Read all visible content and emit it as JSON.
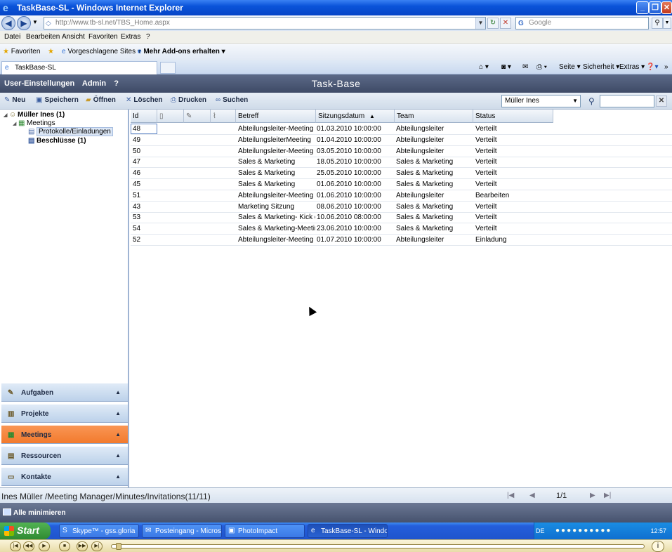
{
  "browser": {
    "title": "TaskBase-SL - Windows Internet Explorer",
    "address": "http://www.tb-sl.net/TBS_Home.aspx",
    "search_placeholder": "Google",
    "menu": [
      "Datei",
      "Bearbeiten",
      "Ansicht",
      "Favoriten",
      "Extras",
      "?"
    ],
    "favorites_label": "Favoriten",
    "suggested_sites": "Vorgeschlagene Sites",
    "addons": "Mehr Add-ons erhalten",
    "tab_label": "TaskBase-SL",
    "commands": [
      "Seite",
      "Sicherheit",
      "Extras"
    ]
  },
  "app": {
    "links": [
      "User-Einstellungen",
      "Admin",
      "?"
    ],
    "title": "Task-Base",
    "toolbar": {
      "new": "Neu",
      "save": "Speichern",
      "open": "Öffnen",
      "delete": "Löschen",
      "print": "Drucken",
      "search": "Suchen"
    },
    "user_select": "Müller Ines"
  },
  "tree": {
    "root": "Müller Ines",
    "root_count": "(1)",
    "meetings": "Meetings",
    "protocols": "Protokolle/Einladungen",
    "decisions": "Beschlüsse",
    "decisions_count": "(1)"
  },
  "accordion": [
    "Aufgaben",
    "Projekte",
    "Meetings",
    "Ressourcen",
    "Kontakte"
  ],
  "grid": {
    "headers": {
      "id": "Id",
      "subject": "Betreff",
      "date": "Sitzungsdatum",
      "sort": "▲",
      "team": "Team",
      "status": "Status"
    },
    "rows": [
      {
        "id": "48",
        "subject": "Abteilungsleiter-Meeting",
        "date": "01.03.2010 10:00:00",
        "team": "Abteilungsleiter",
        "status": "Verteilt"
      },
      {
        "id": "49",
        "subject": "AbteilungsleiterMeeting",
        "date": "01.04.2010 10:00:00",
        "team": "Abteilungsleiter",
        "status": "Verteilt"
      },
      {
        "id": "50",
        "subject": "Abteilungsleiter-Meeting",
        "date": "03.05.2010 10:00:00",
        "team": "Abteilungsleiter",
        "status": "Verteilt"
      },
      {
        "id": "47",
        "subject": "Sales & Marketing",
        "date": "18.05.2010 10:00:00",
        "team": "Sales & Marketing",
        "status": "Verteilt"
      },
      {
        "id": "46",
        "subject": "Sales & Marketing",
        "date": "25.05.2010 10:00:00",
        "team": "Sales & Marketing",
        "status": "Verteilt"
      },
      {
        "id": "45",
        "subject": "Sales & Marketing",
        "date": "01.06.2010 10:00:00",
        "team": "Sales & Marketing",
        "status": "Verteilt"
      },
      {
        "id": "51",
        "subject": "Abteilungsleiter-Meeting",
        "date": "01.06.2010 10:00:00",
        "team": "Abteilungsleiter",
        "status": "Bearbeiten"
      },
      {
        "id": "43",
        "subject": "Marketing Sitzung",
        "date": "08.06.2010 10:00:00",
        "team": "Sales & Marketing",
        "status": "Verteilt"
      },
      {
        "id": "53",
        "subject": "Sales & Marketing- Kick of",
        "date": "10.06.2010 08:00:00",
        "team": "Sales & Marketing",
        "status": "Verteilt"
      },
      {
        "id": "54",
        "subject": "Sales & Marketing-Meeting",
        "date": "23.06.2010 10:00:00",
        "team": "Sales & Marketing",
        "status": "Verteilt"
      },
      {
        "id": "52",
        "subject": "Abteilungsleiter-Meeting",
        "date": "01.07.2010 10:00:00",
        "team": "Abteilungsleiter",
        "status": "Einladung"
      }
    ]
  },
  "status": {
    "path": "Ines Müller /Meeting Manager/Minutes/Invitations(11/11)",
    "page": "1/1"
  },
  "minimize_all": "Alle minimieren",
  "taskbar": {
    "start": "Start",
    "tasks": [
      "Skype™ - gss.gloria",
      "Posteingang - Micros...",
      "PhotoImpact",
      "TaskBase-SL - Windo..."
    ],
    "lang": "DE",
    "clock": "12:57"
  }
}
